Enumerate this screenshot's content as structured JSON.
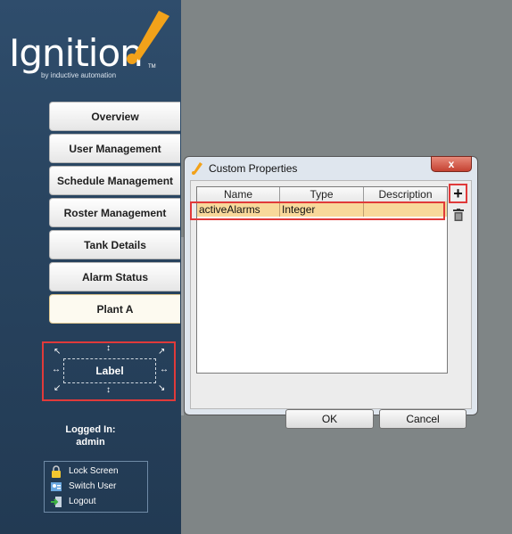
{
  "logo": {
    "wordmark": "Ignition",
    "tagline": "by inductive automation",
    "trademark": "TM"
  },
  "nav": {
    "items": [
      {
        "label": "Overview"
      },
      {
        "label": "User Management"
      },
      {
        "label": "Schedule Management"
      },
      {
        "label": "Roster Management"
      },
      {
        "label": "Tank Details"
      },
      {
        "label": "Alarm Status"
      },
      {
        "label": "Plant A"
      }
    ],
    "active": "Plant A"
  },
  "label_component": {
    "text": "Label"
  },
  "session": {
    "logged_in_label": "Logged In:",
    "username": "admin"
  },
  "actions": [
    {
      "label": "Lock Screen",
      "icon": "lock-icon"
    },
    {
      "label": "Switch User",
      "icon": "switch-user-icon"
    },
    {
      "label": "Logout",
      "icon": "logout-icon"
    }
  ],
  "dialog": {
    "title": "Custom Properties",
    "close_label": "x",
    "columns": [
      "Name",
      "Type",
      "Description"
    ],
    "rows": [
      {
        "name": "activeAlarms",
        "type": "Integer",
        "description": ""
      }
    ],
    "add_label": "+",
    "ok_label": "OK",
    "cancel_label": "Cancel"
  },
  "colors": {
    "sidebar": "#294561",
    "background": "#7f8586",
    "highlight_outline": "#e03a3a",
    "selected_row": "#f8d89a",
    "logo_accent": "#f2a21a"
  }
}
